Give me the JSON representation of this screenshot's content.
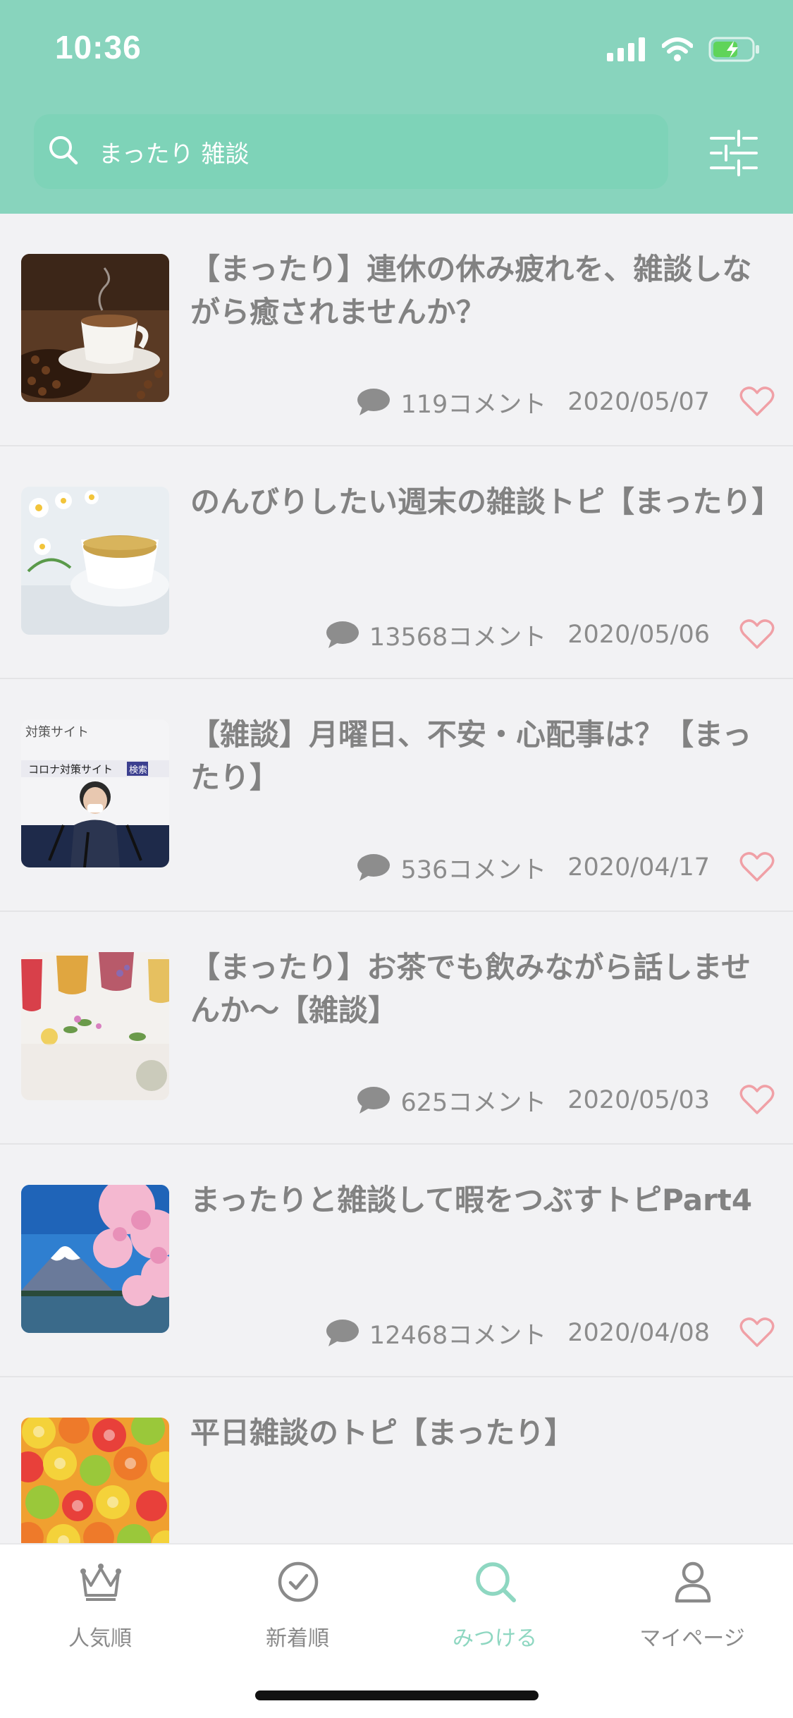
{
  "status_bar": {
    "time": "10:36"
  },
  "search": {
    "query": "まったり 雑談"
  },
  "topics": [
    {
      "title": "【まったり】連休の休み疲れを、雑談しながら癒されませんか？",
      "comments": "119コメント",
      "date": "2020/05/07",
      "thumbnail": "coffee-beans-cup"
    },
    {
      "title": "のんびりしたい週末の雑談トピ【まったり】",
      "comments": "13568コメント",
      "date": "2020/05/06",
      "thumbnail": "chamomile-tea"
    },
    {
      "title": "【雑談】月曜日、不安・心配事は？【まったり】",
      "comments": "536コメント",
      "date": "2020/04/17",
      "thumbnail": "press-conference"
    },
    {
      "title": "【まったり】お茶でも飲みながら話しませんか〜【雑談】",
      "comments": "625コメント",
      "date": "2020/05/03",
      "thumbnail": "herbal-teas"
    },
    {
      "title": "まったりと雑談して暇をつぶすトピPart4",
      "comments": "12468コメント",
      "date": "2020/04/08",
      "thumbnail": "mount-fuji-cherry-blossom"
    },
    {
      "title": "平日雑談のトピ【まったり】",
      "comments": "",
      "date": "",
      "thumbnail": "citrus-candies"
    }
  ],
  "thumb3_text": {
    "line1": "対策サイト",
    "line2": "コロナ対策サイト",
    "badge": "検索"
  },
  "tabs": [
    {
      "label": "人気順",
      "icon": "crown-icon"
    },
    {
      "label": "新着順",
      "icon": "clock-icon"
    },
    {
      "label": "みつける",
      "icon": "search-icon"
    },
    {
      "label": "マイページ",
      "icon": "person-icon"
    }
  ],
  "active_tab": "みつける",
  "colors": {
    "header": "#88d4bd",
    "accent": "#8ed7c1",
    "heart": "#f0a0a6",
    "background": "#f2f2f4"
  }
}
